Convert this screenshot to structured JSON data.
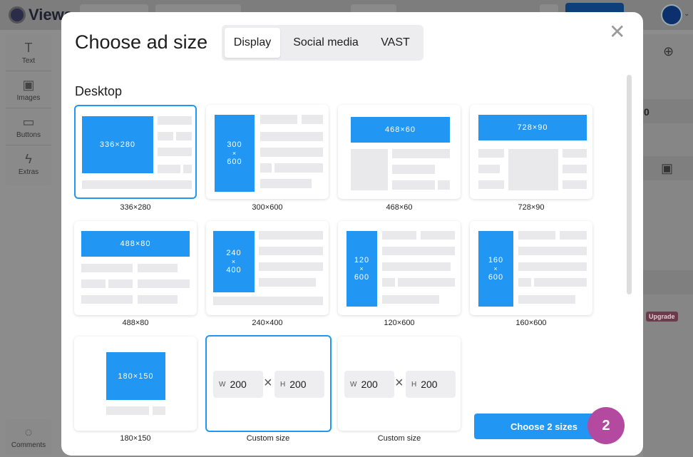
{
  "app": {
    "logo_text": "Views",
    "rail": [
      {
        "label": "Text",
        "icon": "text-icon"
      },
      {
        "label": "Images",
        "icon": "image-icon"
      },
      {
        "label": "Buttons",
        "icon": "button-icon"
      },
      {
        "label": "Extras",
        "icon": "lightning-icon"
      }
    ],
    "comments_label": "Comments",
    "right_panel_digit": "0",
    "upgrade_label": "Upgrade"
  },
  "modal": {
    "title": "Choose ad size",
    "tabs": [
      {
        "label": "Display",
        "active": true
      },
      {
        "label": "Social media",
        "active": false
      },
      {
        "label": "VAST",
        "active": false
      }
    ],
    "close_icon": "close-icon",
    "section_title": "Desktop",
    "sizes": [
      {
        "label": "336×280",
        "preview": "336×280",
        "selected": true
      },
      {
        "label": "300×600",
        "preview": "300 × 600",
        "selected": false
      },
      {
        "label": "468×60",
        "preview": "468×60",
        "selected": false
      },
      {
        "label": "728×90",
        "preview": "728×90",
        "selected": false
      },
      {
        "label": "488×80",
        "preview": "488×80",
        "selected": false
      },
      {
        "label": "240×400",
        "preview": "240 × 400",
        "selected": false
      },
      {
        "label": "120×600",
        "preview": "120 × 600",
        "selected": false
      },
      {
        "label": "160×600",
        "preview": "160 × 600",
        "selected": false
      },
      {
        "label": "180×150",
        "preview": "180×150",
        "selected": false
      }
    ],
    "custom": [
      {
        "label": "Custom size",
        "w_unit": "W",
        "w_value": "200",
        "h_unit": "H",
        "h_value": "200",
        "selected": true
      },
      {
        "label": "Custom size",
        "w_unit": "W",
        "w_value": "200",
        "h_unit": "H",
        "h_value": "200",
        "selected": false
      }
    ],
    "times_symbol": "×",
    "choose_button_label": "Choose 2 sizes",
    "selected_count": "2"
  },
  "colors": {
    "accent": "#2196f3",
    "badge": "#b44aa0",
    "overlay": "#8c8c8c"
  }
}
